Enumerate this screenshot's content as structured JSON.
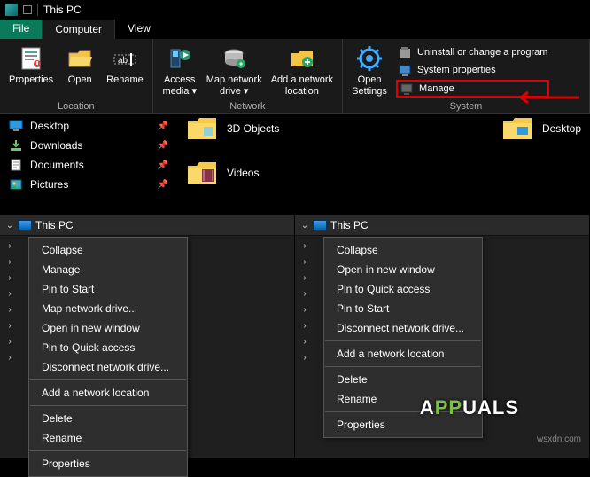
{
  "titlebar": {
    "title": "This PC"
  },
  "tabs": {
    "file": "File",
    "computer": "Computer",
    "view": "View"
  },
  "ribbon": {
    "location": {
      "label": "Location",
      "properties": "Properties",
      "open": "Open",
      "rename": "Rename"
    },
    "network": {
      "label": "Network",
      "access_media": "Access\nmedia ▾",
      "map_drive": "Map network\ndrive ▾",
      "add_location": "Add a network\nlocation"
    },
    "system": {
      "label": "System",
      "open_settings": "Open\nSettings",
      "uninstall": "Uninstall or change a program",
      "sys_props": "System properties",
      "manage": "Manage"
    }
  },
  "sidebar": {
    "items": [
      {
        "label": "Desktop"
      },
      {
        "label": "Downloads"
      },
      {
        "label": "Documents"
      },
      {
        "label": "Pictures"
      }
    ]
  },
  "main": {
    "items": [
      {
        "label": "3D Objects"
      },
      {
        "label": "Desktop"
      },
      {
        "label": "Videos"
      }
    ]
  },
  "tree": {
    "this_pc": "This PC"
  },
  "context_left": {
    "items": [
      "Collapse",
      "Manage",
      "Pin to Start",
      "Map network drive...",
      "Open in new window",
      "Pin to Quick access",
      "Disconnect network drive...",
      "-",
      "Add a network location",
      "-",
      "Delete",
      "Rename",
      "-",
      "Properties"
    ]
  },
  "context_right": {
    "items": [
      "Collapse",
      "Open in new window",
      "Pin to Quick access",
      "Pin to Start",
      "Disconnect network drive...",
      "-",
      "Add a network location",
      "-",
      "Delete",
      "Rename",
      "-",
      "Properties"
    ]
  },
  "watermark": {
    "pre": "A",
    "green": "PP",
    "post": "UALS"
  },
  "footer": "wsxdn.com"
}
